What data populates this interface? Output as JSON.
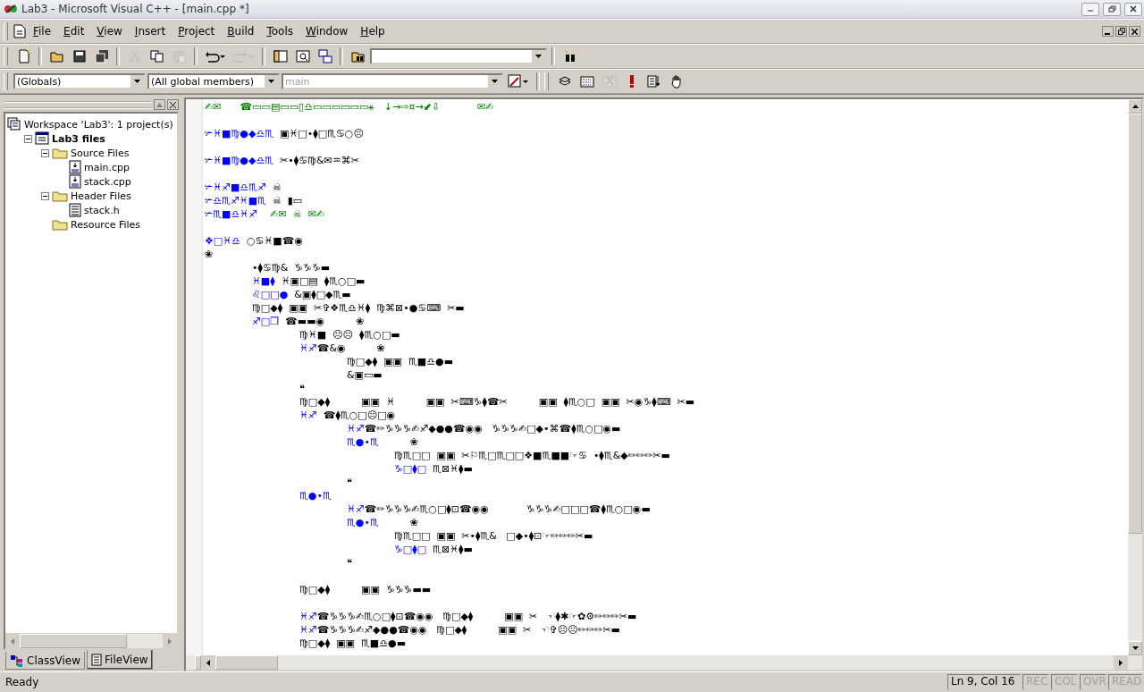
{
  "window": {
    "title": "Lab3 - Microsoft Visual C++ - [main.cpp *]"
  },
  "menu": [
    "File",
    "Edit",
    "View",
    "Insert",
    "Project",
    "Build",
    "Tools",
    "Window",
    "Help"
  ],
  "toolbar": [
    {
      "kind": "new",
      "disabled": false
    },
    {
      "kind": "sep"
    },
    {
      "kind": "open",
      "disabled": false
    },
    {
      "kind": "save",
      "disabled": false
    },
    {
      "kind": "saveall",
      "disabled": false
    },
    {
      "kind": "sep"
    },
    {
      "kind": "cut",
      "disabled": true
    },
    {
      "kind": "copy",
      "disabled": false
    },
    {
      "kind": "paste",
      "disabled": true
    },
    {
      "kind": "sep"
    },
    {
      "kind": "undo",
      "disabled": false
    },
    {
      "kind": "redo",
      "disabled": true
    },
    {
      "kind": "sep"
    },
    {
      "kind": "workspace",
      "disabled": false
    },
    {
      "kind": "output",
      "disabled": false
    },
    {
      "kind": "windows",
      "disabled": false
    },
    {
      "kind": "sep"
    },
    {
      "kind": "findfiles",
      "disabled": false
    },
    {
      "kind": "combo"
    },
    {
      "kind": "sep"
    },
    {
      "kind": "find",
      "disabled": false
    }
  ],
  "wizard_bar": {
    "combos": [
      {
        "value": "(Globals)",
        "disabled": false
      },
      {
        "value": "(All global members)",
        "disabled": false
      },
      {
        "value": "main",
        "disabled": true
      }
    ]
  },
  "build_toolbar": [
    {
      "kind": "compile",
      "disabled": false
    },
    {
      "kind": "build",
      "disabled": false
    },
    {
      "kind": "stop",
      "disabled": true
    },
    {
      "kind": "execute",
      "disabled": false
    },
    {
      "kind": "go",
      "disabled": false
    },
    {
      "kind": "breakpoint",
      "disabled": false
    }
  ],
  "workspace_tree": [
    {
      "label": "Workspace 'Lab3': 1 project(s)",
      "kind": "workspace",
      "children": [
        {
          "label": "Lab3 files",
          "kind": "project",
          "expanded": true,
          "children": [
            {
              "label": "Source Files",
              "kind": "folder",
              "expanded": true,
              "children": [
                {
                  "label": "main.cpp",
                  "kind": "source"
                },
                {
                  "label": "stack.cpp",
                  "kind": "source"
                }
              ]
            },
            {
              "label": "Header Files",
              "kind": "folder",
              "expanded": true,
              "children": [
                {
                  "label": "stack.h",
                  "kind": "header"
                }
              ]
            },
            {
              "label": "Resource Files",
              "kind": "folder"
            }
          ]
        }
      ]
    }
  ],
  "panel_tabs": [
    {
      "label": "ClassView",
      "kind": "class",
      "selected": false
    },
    {
      "label": "FileView",
      "kind": "file",
      "selected": true
    }
  ],
  "editor_lines": [
    {
      "kind": "code",
      "parts": [
        {
          "kind": "comment",
          "text": "✍✉      ☎▭▭▤▭▭▯♎▭▭▭▭▭▭⚹   ↓→⇨¤→⬋⇩            ✉✍"
        }
      ]
    },
    {
      "kind": "blank"
    },
    {
      "kind": "code",
      "parts": [
        {
          "kind": "kw",
          "text": "✃♓■♍●◆♎♏"
        },
        {
          "kind": "plain",
          "text": "  ▣♓□•⧫□♏♋○☹"
        }
      ]
    },
    {
      "kind": "blank"
    },
    {
      "kind": "code",
      "parts": [
        {
          "kind": "kw",
          "text": "✃♓■♍●◆♎♏"
        },
        {
          "kind": "plain",
          "text": "  ✂•⧫♋♍&✉♒⌘✂"
        }
      ]
    },
    {
      "kind": "blank"
    },
    {
      "kind": "code",
      "parts": [
        {
          "kind": "kw",
          "text": "✃♓♐■♎♏♐"
        },
        {
          "kind": "plain",
          "text": "  ☠"
        }
      ]
    },
    {
      "kind": "code",
      "parts": [
        {
          "kind": "kw",
          "text": "✃♎♏♐♓■♏"
        },
        {
          "kind": "plain",
          "text": "  ☠  ▮▭"
        }
      ]
    },
    {
      "kind": "code",
      "parts": [
        {
          "kind": "kw",
          "text": "✃♏■♎♓♐"
        },
        {
          "kind": "comment",
          "text": "✍✉  ☠  ✉✍"
        }
      ]
    },
    {
      "kind": "blank"
    },
    {
      "kind": "code",
      "parts": [
        {
          "kind": "kw",
          "text": "❖□♓♎"
        },
        {
          "kind": "plain",
          "text": "  ○♋♓■☎◉"
        }
      ]
    },
    {
      "kind": "code",
      "parts": [
        {
          "kind": "plain",
          "text": "❀"
        }
      ],
      "children": [
        {
          "kind": "code",
          "parts": [
            {
              "kind": "plain",
              "text": "•⧫♋♍&  ♑♑♑▬"
            }
          ]
        },
        {
          "kind": "code",
          "parts": [
            {
              "kind": "kw",
              "text": "♓■⧫"
            },
            {
              "kind": "plain",
              "text": "  ♓▣□▤  ⧫♏○□▬"
            }
          ]
        },
        {
          "kind": "code",
          "parts": [
            {
              "kind": "kw",
              "text": "♌□□●"
            },
            {
              "kind": "plain",
              "text": "  &▣⧫□◆♏▬"
            }
          ]
        },
        {
          "kind": "code",
          "parts": [
            {
              "kind": "plain",
              "text": "♍□◆⧫  ▣▣  ✂✞❖♏♎♓⧫  ♍⌘⊠•●♋⌨  ✂▬"
            }
          ]
        },
        {
          "kind": "code",
          "parts": [
            {
              "kind": "kw",
              "text": "♐□❒"
            },
            {
              "kind": "plain",
              "text": "  ☎▬▬◉          ❀"
            }
          ],
          "children": [
            {
              "kind": "code",
              "parts": [
                {
                  "kind": "plain",
                  "text": "♍♓■  ☹☹  ⧫♏○□▬"
                }
              ]
            },
            {
              "kind": "code",
              "parts": [
                {
                  "kind": "kw",
                  "text": "♓♐"
                },
                {
                  "kind": "plain",
                  "text": "☎&◉          ❀"
                }
              ],
              "children": [
                {
                  "kind": "code",
                  "parts": [
                    {
                      "kind": "plain",
                      "text": "♍□◆⧫  ▣▣  ♏■♎●▬"
                    }
                  ]
                },
                {
                  "kind": "code",
                  "parts": [
                    {
                      "kind": "plain",
                      "text": "&▣▭▬"
                    }
                  ]
                }
              ]
            },
            {
              "kind": "code",
              "parts": [
                {
                  "kind": "plain",
                  "text": "❝"
                }
              ]
            },
            {
              "kind": "code",
              "parts": [
                {
                  "kind": "plain",
                  "text": "♍□◆⧫          ▣▣  ♓          ▣▣  ✂⌨♑⧫☎✂          ▣▣  ⧫♏○□  ▣▣  ✂◉♑⧫⌨  ✂▬"
                }
              ]
            },
            {
              "kind": "code",
              "parts": [
                {
                  "kind": "kw",
                  "text": "♓♐"
                },
                {
                  "kind": "plain",
                  "text": "  ☎⧫♏○□☹□◉"
                }
              ],
              "children": [
                {
                  "kind": "code",
                  "parts": [
                    {
                      "kind": "kw",
                      "text": "♓♐"
                    },
                    {
                      "kind": "plain",
                      "text": "☎✏♑♑♑✍♐◆●●☎◉◉   ♑♑♑✍□◆•⌘☎⧫♏○□◉▬"
                    }
                  ]
                },
                {
                  "kind": "code",
                  "parts": [
                    {
                      "kind": "kw",
                      "text": "♏●•♏"
                    },
                    {
                      "kind": "plain",
                      "text": "          ❀"
                    }
                  ],
                  "children": [
                    {
                      "kind": "code",
                      "parts": [
                        {
                          "kind": "plain",
                          "text": "♍♏□□  ▣▣  ✂⚐♏□♏□□❖■♏■■☞♋  •⧫♏&◆✏✏✏✂▬"
                        }
                      ]
                    },
                    {
                      "kind": "code",
                      "parts": [
                        {
                          "kind": "kw",
                          "text": "♑□⧫□"
                        },
                        {
                          "kind": "plain",
                          "text": "  ♏⊠♓⧫▬"
                        }
                      ]
                    }
                  ]
                },
                {
                  "kind": "code",
                  "parts": [
                    {
                      "kind": "plain",
                      "text": "❝"
                    }
                  ]
                }
              ]
            },
            {
              "kind": "code",
              "parts": [
                {
                  "kind": "kw",
                  "text": "♏●•♏"
                }
              ],
              "children": [
                {
                  "kind": "code",
                  "parts": [
                    {
                      "kind": "kw",
                      "text": "♓♐"
                    },
                    {
                      "kind": "plain",
                      "text": "☎✏♑♑♑✍♏○□⧫⊡☎◉◉            ♑♑♑✍□□□☎⧫♏○□◉▬"
                    }
                  ]
                },
                {
                  "kind": "code",
                  "parts": [
                    {
                      "kind": "kw",
                      "text": "♏●•♏"
                    },
                    {
                      "kind": "plain",
                      "text": "          ❀"
                    }
                  ],
                  "children": [
                    {
                      "kind": "code",
                      "parts": [
                        {
                          "kind": "plain",
                          "text": "♍♏□□  ▣▣  ✂•⧫♏&   □◆•⧫⊡☞✏✏✏✂▬"
                        }
                      ]
                    },
                    {
                      "kind": "code",
                      "parts": [
                        {
                          "kind": "kw",
                          "text": "♑□⧫□"
                        },
                        {
                          "kind": "plain",
                          "text": "  ♏⊠♓⧫▬"
                        }
                      ]
                    }
                  ]
                },
                {
                  "kind": "code",
                  "parts": [
                    {
                      "kind": "plain",
                      "text": "❝"
                    }
                  ]
                }
              ]
            },
            {
              "kind": "blank"
            },
            {
              "kind": "code",
              "parts": [
                {
                  "kind": "plain",
                  "text": "♍□◆⧫          ▣▣  ♑♑♑▬▬"
                }
              ]
            },
            {
              "kind": "blank"
            },
            {
              "kind": "code",
              "parts": [
                {
                  "kind": "kw",
                  "text": "♓♐"
                },
                {
                  "kind": "plain",
                  "text": "☎♑♑♑✍♏○□⧫⊡☎◉◉   ♍□◆⧫          ▣▣  ✂   ☜⧫✱☞✿⚙✏✏✏✂▬"
                }
              ]
            },
            {
              "kind": "code",
              "parts": [
                {
                  "kind": "kw",
                  "text": "♓♐"
                },
                {
                  "kind": "plain",
                  "text": "☎♑♑♑✍♐◆●●☎◉◉   ♍□◆⧫          ▣▣  ✂   ☜✞☹☹✏✏✏✂▬"
                }
              ]
            },
            {
              "kind": "code",
              "parts": [
                {
                  "kind": "plain",
                  "text": "♍□◆⧫  ▣▣  ♏■♎●▬"
                }
              ]
            }
          ]
        }
      ]
    }
  ],
  "status_bar": {
    "message": "Ready",
    "position": "Ln 9, Col 16",
    "indicators": [
      {
        "label": "REC",
        "on": false
      },
      {
        "label": "COL",
        "on": false
      },
      {
        "label": "OVR",
        "on": false
      },
      {
        "label": "READ",
        "on": false
      }
    ]
  }
}
